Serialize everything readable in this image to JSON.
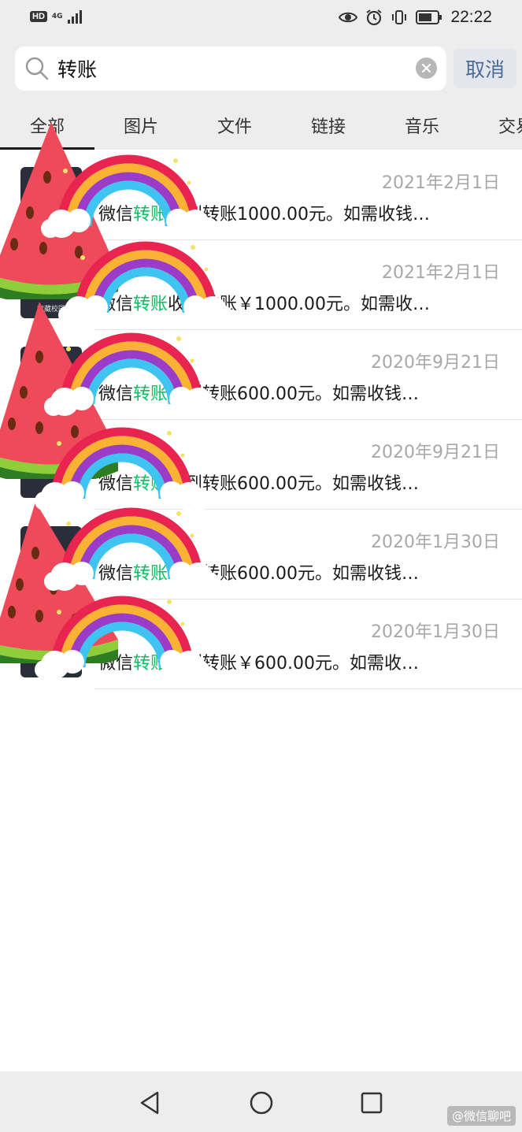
{
  "status_bar": {
    "hd": "HD",
    "network": "4G",
    "time": "22:22",
    "icons": [
      "eye-icon",
      "alarm-icon",
      "vibrate-icon",
      "battery-icon"
    ]
  },
  "search": {
    "value": "转账",
    "cancel_label": "取消"
  },
  "tabs": [
    {
      "label": "全部",
      "active": true
    },
    {
      "label": "图片",
      "active": false
    },
    {
      "label": "文件",
      "active": false
    },
    {
      "label": "链接",
      "active": false
    },
    {
      "label": "音乐",
      "active": false
    },
    {
      "label": "交易",
      "active": false
    }
  ],
  "results": [
    {
      "date": "2021年2月1日",
      "prefix": "微信",
      "highlight": "转账",
      "suffix": "收到转账1000.00元。如需收钱…",
      "thumb_label": ""
    },
    {
      "date": "2021年2月1日",
      "prefix": "微信",
      "highlight": "转账",
      "suffix": "收到转账￥1000.00元。如需收…",
      "thumb_label": "宝藏校园"
    },
    {
      "date": "2020年9月21日",
      "prefix": "微信",
      "highlight": "转账",
      "suffix": "收到转账600.00元。如需收钱…",
      "thumb_label": ""
    },
    {
      "date": "2020年9月21日",
      "prefix": "微信",
      "highlight": "转账",
      "suffix": "收到转账600.00元。如需收钱…",
      "thumb_label": ""
    },
    {
      "date": "2020年1月30日",
      "prefix": "微信",
      "highlight": "转账",
      "suffix": "收到转账600.00元。如需收钱…",
      "thumb_label": ""
    },
    {
      "date": "2020年1月30日",
      "prefix": "微信",
      "highlight": "转账",
      "suffix": "收到转账￥600.00元。如需收…",
      "thumb_label": ""
    }
  ],
  "colors": {
    "highlight": "#07c160",
    "cancel_text": "#4e6a97",
    "date_text": "#a8a8a8",
    "bar_bg": "#ededed"
  },
  "nav": {
    "icons": [
      "back-icon",
      "home-icon",
      "recents-icon"
    ]
  },
  "watermark": "@微信聊吧"
}
